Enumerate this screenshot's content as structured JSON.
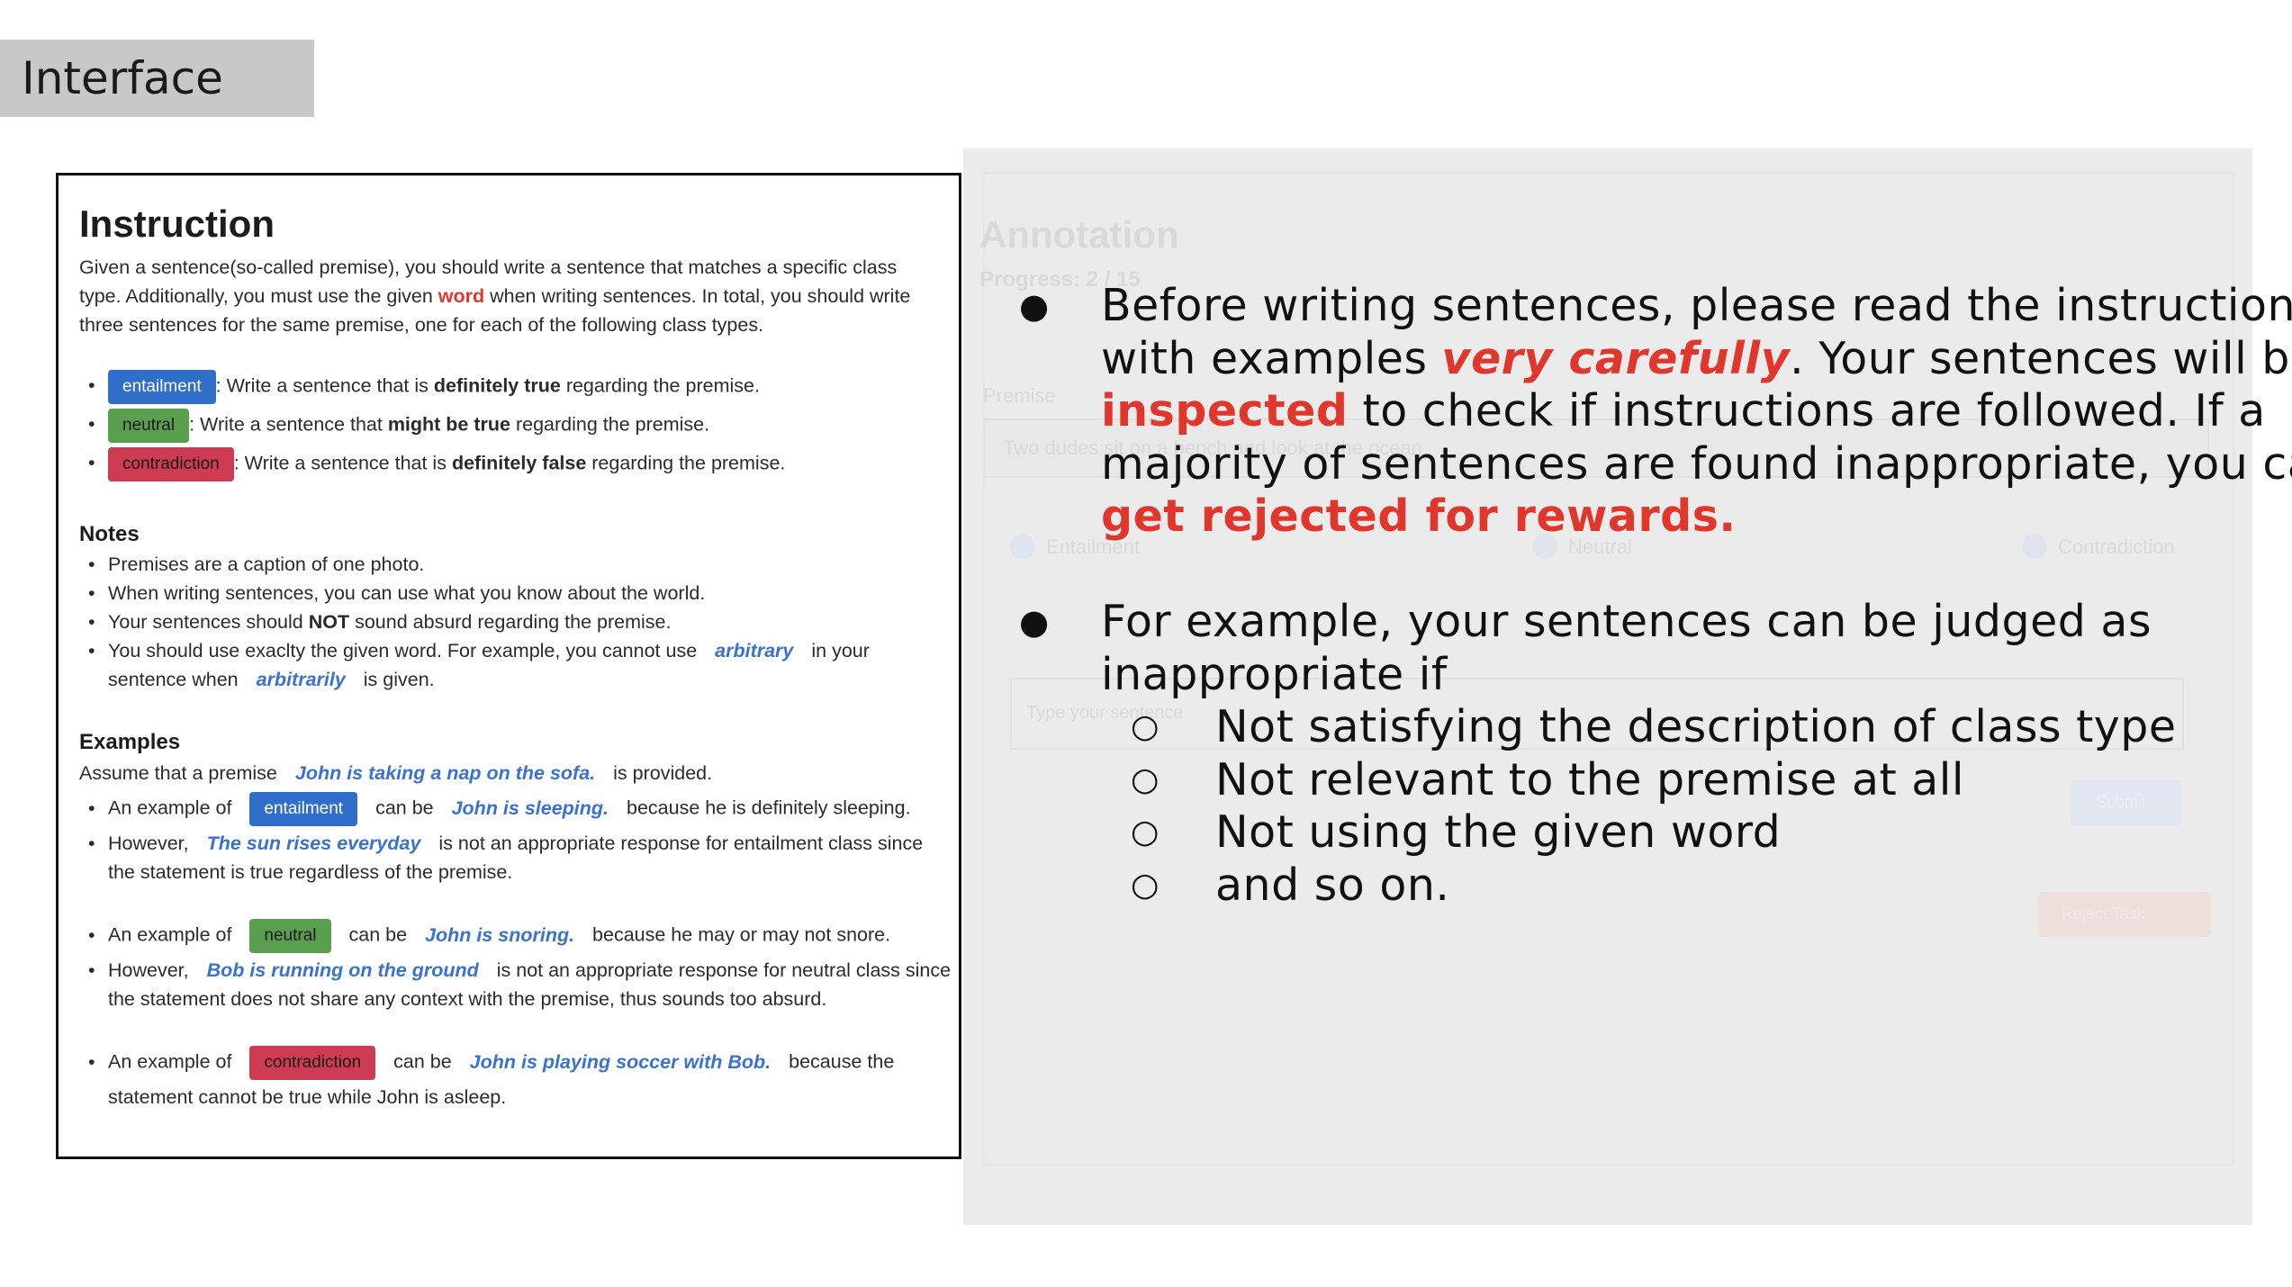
{
  "slide": {
    "title": "Interface"
  },
  "instruction": {
    "heading": "Instruction",
    "intro_line1": "Given a sentence(so-called premise), you should write a sentence that matches a specific class",
    "intro_line2_a": "type. Additionally, you must use the given ",
    "intro_line2_word": "word",
    "intro_line2_b": " when writing sentences. In total, you should write",
    "intro_line3": "three sentences for the same premise, one for each of the following class types.",
    "classes": [
      {
        "label": "entailment",
        "text_a": ": Write a sentence that is ",
        "bold": "definitely true",
        "text_b": " regarding the premise."
      },
      {
        "label": "neutral",
        "text_a": ": Write a sentence that ",
        "bold": "might be true",
        "text_b": " regarding the premise."
      },
      {
        "label": "contradiction",
        "text_a": ": Write a sentence that is ",
        "bold": "definitely false",
        "text_b": " regarding the premise."
      }
    ],
    "notes_heading": "Notes",
    "notes": {
      "n1": "Premises are a caption of one photo.",
      "n2": "When writing sentences, you can use what you know about the world.",
      "n3_a": "Your sentences should ",
      "n3_bold": "NOT",
      "n3_b": " sound absurd regarding the premise.",
      "n4_a": "You should use exaclty the given word. For example, you cannot use ",
      "n4_ex": "arbitrary",
      "n4_b": " in your",
      "n4_c": "sentence when ",
      "n4_ex2": "arbitrarily",
      "n4_d": " is given."
    },
    "examples_heading": "Examples",
    "examples": {
      "assume_a": "Assume that a premise ",
      "assume_ex": "John is taking a nap on the sofa.",
      "assume_b": " is provided.",
      "e1_a": "An example of ",
      "e1_badge": "entailment",
      "e1_b": " can be ",
      "e1_ex": "John is sleeping.",
      "e1_c": " because he is definitely sleeping.",
      "e2_a": "However, ",
      "e2_ex": "The sun rises everyday",
      "e2_b": " is not an appropriate response for entailment class since",
      "e2_c": "the statement is true regardless of the premise.",
      "e3_a": "An example of ",
      "e3_badge": "neutral",
      "e3_b": " can be ",
      "e3_ex": "John is snoring.",
      "e3_c": " because he may or may not snore.",
      "e4_a": "However, ",
      "e4_ex": "Bob is running on the ground",
      "e4_b": " is not an appropriate response for neutral class since",
      "e4_c": "the statement does not share any context with the premise, thus sounds too absurd.",
      "e5_a": "An example of ",
      "e5_badge": "contradiction",
      "e5_b": " can be ",
      "e5_ex": "John is playing soccer with Bob.",
      "e5_c": " because the",
      "e5_d": "statement cannot be true while John is asleep."
    }
  },
  "annotation_background": {
    "heading": "Annotation",
    "progress": "Progress: 2 / 15",
    "premise_label": "Premise",
    "premise_text": "Two dudes sit on a bench and look at the ocean",
    "radio_labels": [
      "Entailment",
      "Neutral",
      "Contradiction"
    ],
    "input_placeholder": "Type your sentence",
    "submit_label": "Submit",
    "reject_label": "Reject Task"
  },
  "overlay": {
    "p1_l1": "Before writing sentences, please read the instruction",
    "p1_l2_a": "with examples ",
    "p1_l2_em": "very carefully",
    "p1_l2_b": ". Your sentences will be",
    "p1_l3_em": "inspected",
    "p1_l3_b": " to check if instructions are followed. If a",
    "p1_l4": "majority of sentences are found inappropriate, you can",
    "p1_l5_em": "get rejected for rewards.",
    "p2_l1": "For example, your sentences can be judged as",
    "p2_l2": "inappropriate if",
    "sub": [
      "Not satisfying the description of class type",
      "Not relevant to the premise at all",
      "Not using the given word",
      "and so on."
    ]
  },
  "colors": {
    "accent_red": "#e0362c",
    "entailment": "#2f6fca",
    "neutral": "#5a9e4f",
    "contradiction": "#cf3b52",
    "example_blue": "#3a72cf"
  }
}
